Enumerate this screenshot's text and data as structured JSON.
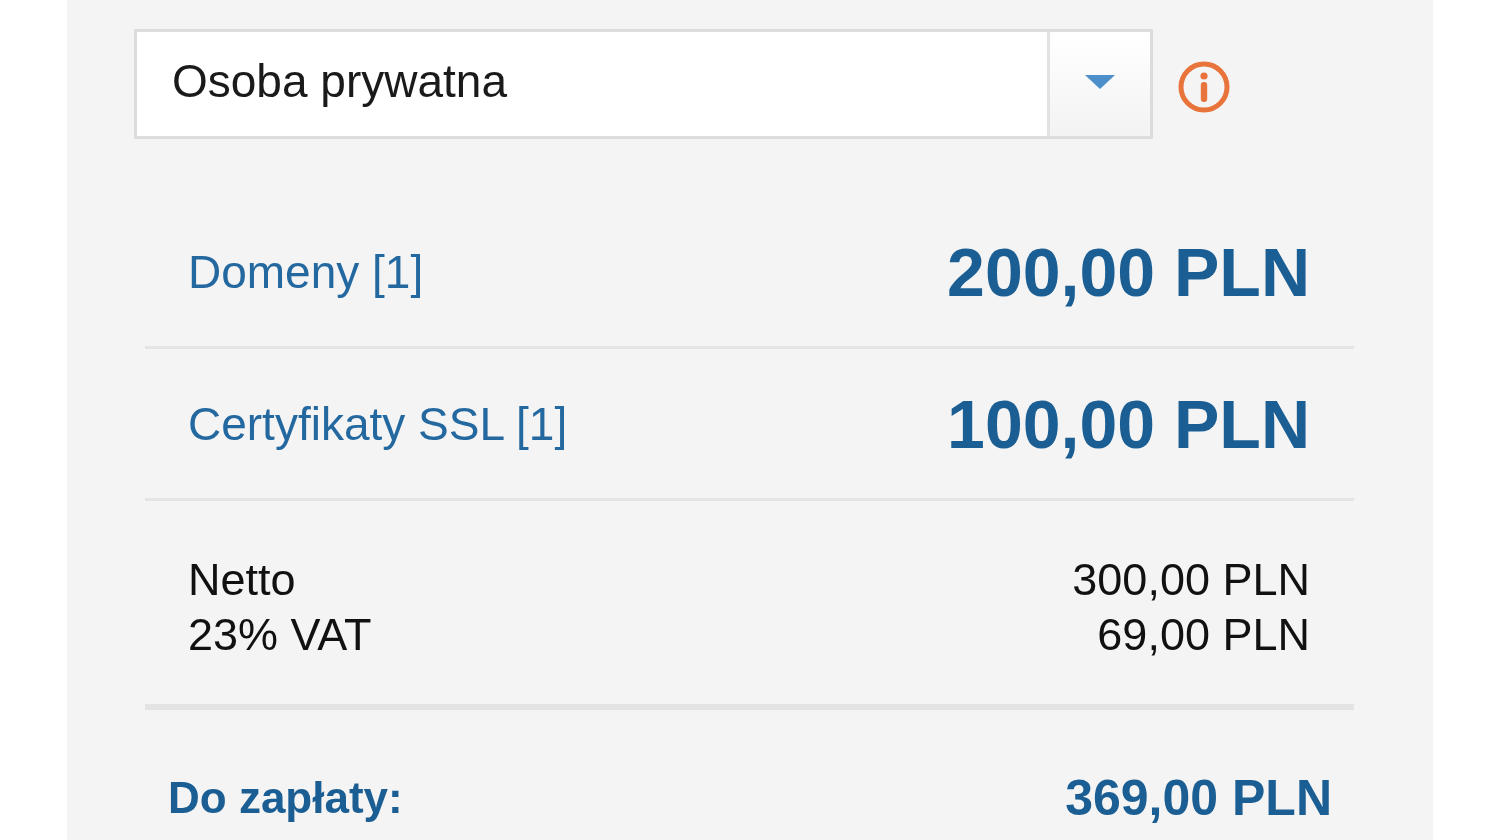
{
  "customer_type_select": {
    "value": "Osoba prywatna"
  },
  "items": [
    {
      "label": "Domeny [1]",
      "amount": "200,00 PLN"
    },
    {
      "label": "Certyfikaty SSL [1]",
      "amount": "100,00 PLN"
    }
  ],
  "summary": [
    {
      "label": "Netto",
      "amount": "300,00 PLN"
    },
    {
      "label": "23% VAT",
      "amount": "69,00 PLN"
    }
  ],
  "total": {
    "label": "Do zapłaty:",
    "amount": "369,00 PLN"
  }
}
